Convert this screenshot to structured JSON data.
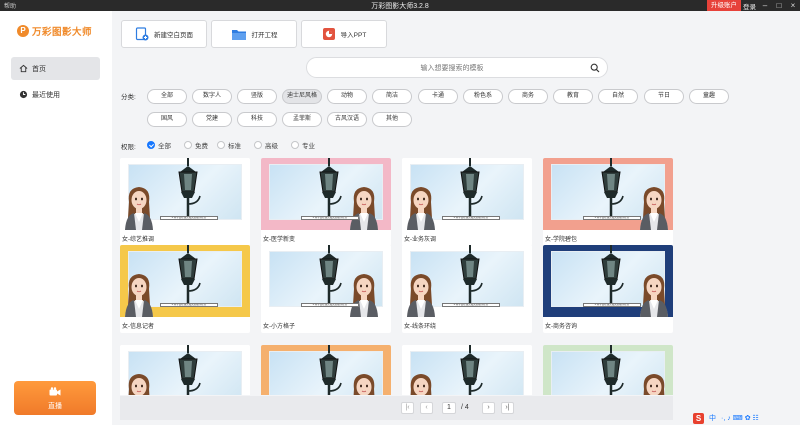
{
  "window": {
    "help_label": "帮助",
    "title": "万彩图影大师3.2.8",
    "upgrade_label": "升级账户",
    "login_label": "登录"
  },
  "sidebar": {
    "logo_text": "万彩图影大师",
    "items": [
      {
        "label": "首页",
        "icon": "home-icon",
        "active": true
      },
      {
        "label": "最近使用",
        "icon": "clock-icon",
        "active": false
      }
    ],
    "live_label": "直播"
  },
  "actions": [
    {
      "label": "新建空白页面",
      "icon": "new-page-icon"
    },
    {
      "label": "打开工程",
      "icon": "folder-icon"
    },
    {
      "label": "导入PPT",
      "icon": "ppt-icon"
    }
  ],
  "search": {
    "placeholder": "输入想要搜索的模板"
  },
  "categories": {
    "label": "分类:",
    "items": [
      "全部",
      "数字人",
      "竖版",
      "迪士尼风格",
      "动物",
      "简洁",
      "卡通",
      "粉色系",
      "商务",
      "教育",
      "自然",
      "节日",
      "童趣",
      "国风",
      "党建",
      "科技",
      "孟菲斯",
      "古风汉语",
      "其他"
    ],
    "selected": "迪士尼风格"
  },
  "permissions": {
    "label": "权限:",
    "items": [
      "全部",
      "免费",
      "标准",
      "高级",
      "专业"
    ],
    "selected": "全部"
  },
  "templates": [
    {
      "caption": "女-综艺推调",
      "frame": "#ffffff"
    },
    {
      "caption": "女-医学新变",
      "frame": "#f3b8c7"
    },
    {
      "caption": "女-业务灰调",
      "frame": "#ffffff"
    },
    {
      "caption": "女-学院碧包",
      "frame": "#f2a08e"
    },
    {
      "caption": "女-信息记者",
      "frame": "#f5c84a"
    },
    {
      "caption": "女-小方格子",
      "frame": "#ffffff"
    },
    {
      "caption": "女-线条环绕",
      "frame": "#ffffff"
    },
    {
      "caption": "女-商务咨询",
      "frame": "#1f3e7a"
    },
    {
      "caption": "",
      "frame": "#ffffff"
    },
    {
      "caption": "",
      "frame": "#f5b06e"
    },
    {
      "caption": "",
      "frame": "#ffffff"
    },
    {
      "caption": "",
      "frame": "#cfe6c8"
    }
  ],
  "banner_text": "# 同学请在线完成实验操作任务",
  "pagination": {
    "current": "1",
    "total": "/ 4"
  },
  "ime": {
    "mode": "中",
    "extra": "·, ♪ ⌨ ✿ ☷"
  }
}
